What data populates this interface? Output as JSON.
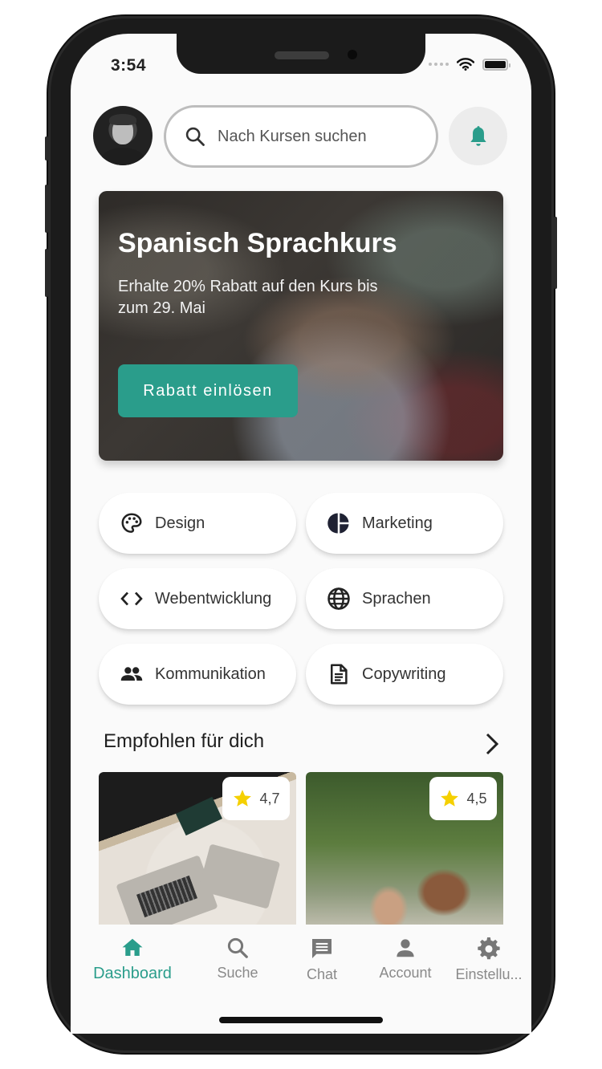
{
  "status_bar": {
    "time": "3:54"
  },
  "header": {
    "search": {
      "placeholder": "Nach Kursen suchen",
      "value": ""
    },
    "avatar_alt": "Profilbild",
    "notification_icon": "bell-icon"
  },
  "promo": {
    "title": "Spanisch Sprachkurs",
    "subtitle": "Erhalte 20% Rabatt auf den Kurs bis zum 29. Mai",
    "button_label": "Rabatt einlösen"
  },
  "categories": [
    {
      "label": "Design",
      "icon": "palette-icon"
    },
    {
      "label": "Marketing",
      "icon": "pie-chart-icon"
    },
    {
      "label": "Webentwicklung",
      "icon": "code-icon"
    },
    {
      "label": "Sprachen",
      "icon": "globe-icon"
    },
    {
      "label": "Kommunikation",
      "icon": "people-icon"
    },
    {
      "label": "Copywriting",
      "icon": "document-icon"
    }
  ],
  "recommended": {
    "title": "Empfohlen für dich",
    "courses": [
      {
        "rating": "4,7"
      },
      {
        "rating": "4,5"
      }
    ]
  },
  "nav": {
    "items": [
      {
        "label": "Dashboard",
        "icon": "home-icon",
        "active": true
      },
      {
        "label": "Suche",
        "icon": "search-icon",
        "active": false
      },
      {
        "label": "Chat",
        "icon": "chat-icon",
        "active": false
      },
      {
        "label": "Account",
        "icon": "person-icon",
        "active": false
      },
      {
        "label": "Einstellu...",
        "icon": "gear-icon",
        "active": false
      }
    ]
  },
  "colors": {
    "accent": "#2a9d8b",
    "star": "#f5d000",
    "inactive": "#8a8a8a"
  }
}
